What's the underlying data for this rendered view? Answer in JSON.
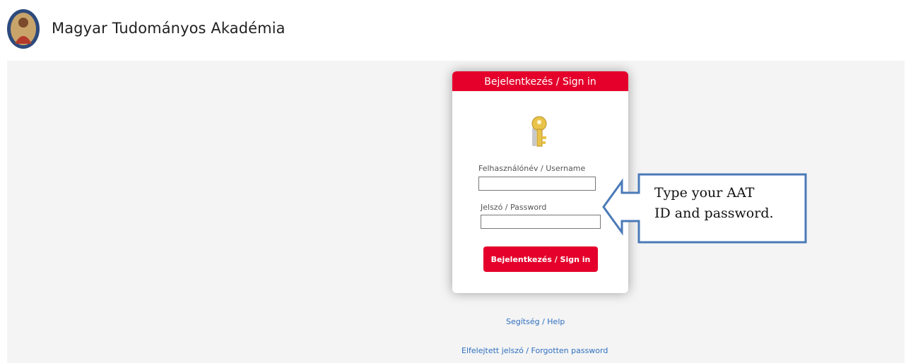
{
  "header": {
    "title": "Magyar Tudományos Akadémia",
    "logo_icon": "academy-seal-icon"
  },
  "login": {
    "heading": "Bejelentkezés / Sign in",
    "key_icon": "key-icon",
    "username_label": "Felhasználónév / Username",
    "username_value": "",
    "password_label": "Jelszó / Password",
    "password_value": "",
    "submit_label": "Bejelentkezés / Sign in"
  },
  "links": {
    "help": "Segítség / Help",
    "forgotten_password": "Elfelejtett jelszó / Forgotten password"
  },
  "callout": {
    "line1": "Type your AAT",
    "line2": "ID and password."
  },
  "colors": {
    "brand_red": "#e4002b",
    "link_blue": "#2f6fbf",
    "callout_border": "#4a7ab8",
    "background": "#f4f4f4"
  }
}
